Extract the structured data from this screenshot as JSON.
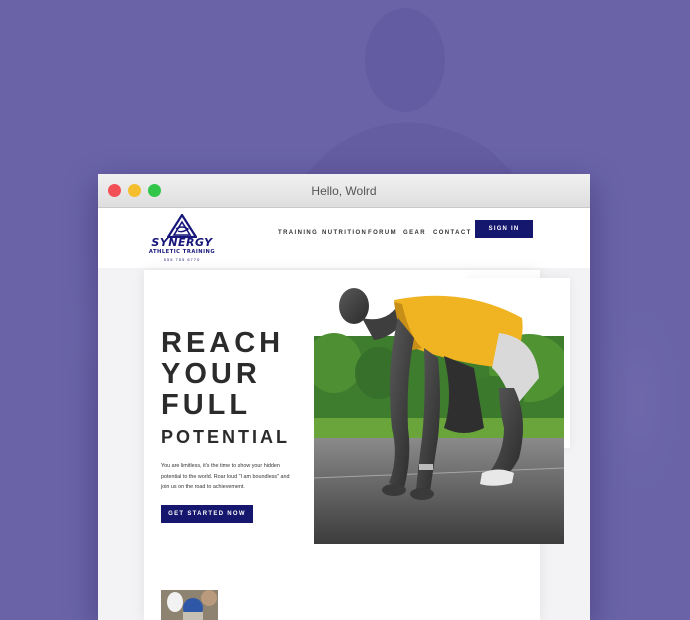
{
  "window": {
    "title": "Hello, Wolrd"
  },
  "site": {
    "logo": {
      "name": "SYNERGY",
      "tagline": "ATHLETIC TRAINING",
      "phone": "555 755 6770"
    },
    "nav": {
      "items": [
        {
          "label": "TRAINING"
        },
        {
          "label": "NUTRITION"
        },
        {
          "label": "FORUM"
        },
        {
          "label": "GEAR"
        },
        {
          "label": "CONTACT"
        }
      ],
      "signin_label": "SIGN IN"
    },
    "hero": {
      "line1": "REACH",
      "line2": "YOUR",
      "line3": "FULL",
      "line4": "POTENTIAL",
      "body": "You are limitless, it's the time to show your hidden potential to the world. Roar loud \"I am boundless\" and join us on the road to achievement.",
      "cta_label": "GET STARTED NOW"
    }
  },
  "colors": {
    "background": "#6a63a8",
    "brand_navy": "#15166e",
    "jersey_yellow": "#f0b321"
  }
}
